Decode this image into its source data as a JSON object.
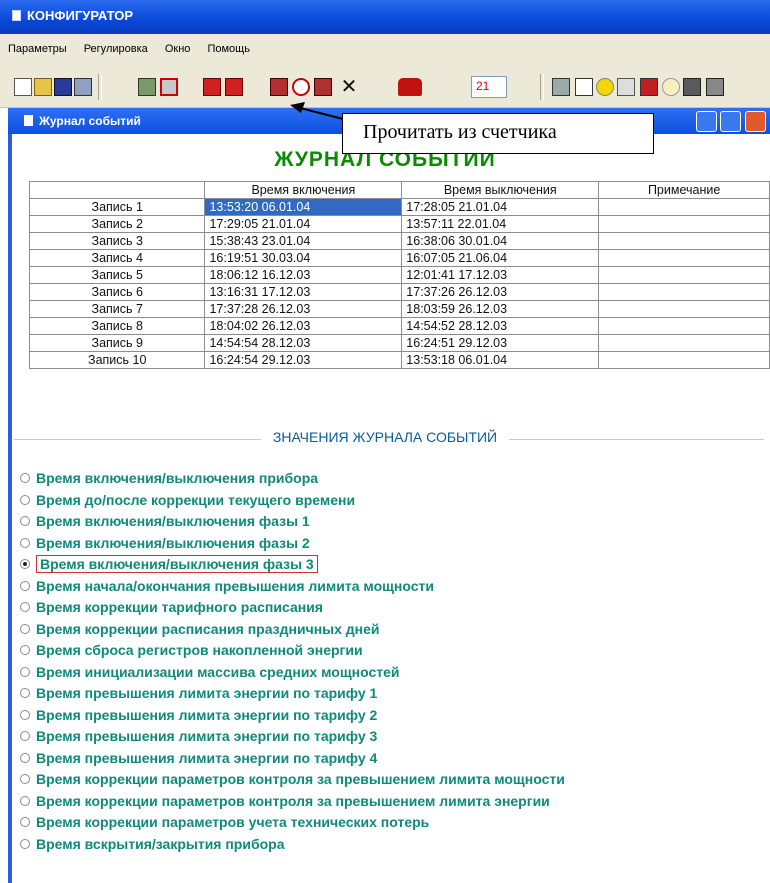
{
  "app": {
    "title": "КОНФИГУРАТОР"
  },
  "menu": [
    "Параметры",
    "Регулировка",
    "Окно",
    "Помощь"
  ],
  "toolbar": {
    "number_value": "21"
  },
  "window": {
    "title": "Журнал событий"
  },
  "callout": {
    "text": "Прочитать из счетчика"
  },
  "journal": {
    "title": "ЖУРНАЛ СОБЫТИЙ",
    "columns": [
      "Время включения",
      "Время выключения",
      "Примечание"
    ],
    "rows": [
      {
        "label": "Запись 1",
        "on": "13:53:20  06.01.04",
        "off": "17:28:05  21.01.04",
        "note": ""
      },
      {
        "label": "Запись 2",
        "on": "17:29:05  21.01.04",
        "off": "13:57:11  22.01.04",
        "note": ""
      },
      {
        "label": "Запись 3",
        "on": "15:38:43  23.01.04",
        "off": "16:38:06  30.01.04",
        "note": ""
      },
      {
        "label": "Запись 4",
        "on": "16:19:51  30.03.04",
        "off": "16:07:05  21.06.04",
        "note": ""
      },
      {
        "label": "Запись 5",
        "on": "18:06:12  16.12.03",
        "off": "12:01:41  17.12.03",
        "note": ""
      },
      {
        "label": "Запись 6",
        "on": "13:16:31  17.12.03",
        "off": "17:37:26  26.12.03",
        "note": ""
      },
      {
        "label": "Запись 7",
        "on": "17:37:28  26.12.03",
        "off": "18:03:59  26.12.03",
        "note": ""
      },
      {
        "label": "Запись 8",
        "on": "18:04:02  26.12.03",
        "off": "14:54:52  28.12.03",
        "note": ""
      },
      {
        "label": "Запись 9",
        "on": "14:54:54  28.12.03",
        "off": "16:24:51  29.12.03",
        "note": ""
      },
      {
        "label": "Запись 10",
        "on": "16:24:54  29.12.03",
        "off": "13:53:18  06.01.04",
        "note": ""
      }
    ]
  },
  "values_section": {
    "title": "ЗНАЧЕНИЯ ЖУРНАЛА СОБЫТИЙ",
    "options": [
      "Время включения/выключения прибора",
      "Время до/после коррекции текущего времени",
      "Время включения/выключения фазы 1",
      "Время включения/выключения фазы 2",
      "Время включения/выключения фазы 3",
      "Время начала/окончания превышения лимита мощности",
      "Время коррекции тарифного расписания",
      "Время коррекции  расписания праздничных дней",
      "Время сброса регистров накопленной энергии",
      "Время инициализации массива средних мощностей",
      "Время  превышения лимита  энергии по тарифу 1",
      "Время  превышения лимита  энергии по тарифу 2",
      "Время  превышения лимита  энергии по тарифу 3",
      "Время  превышения лимита  энергии по тарифу 4",
      "Время коррекции параметров контроля за превышением лимита мощности",
      "Время коррекции параметров контроля за превышением лимита энергии",
      "Время коррекции параметров учета технических потерь",
      "Время вскрытия/закрытия прибора"
    ],
    "selected_index": 4
  },
  "colors": {
    "title_bar": "#0a48d8",
    "accent_green": "#0a8a00",
    "option_teal": "#0f8a7a",
    "selection": "#316ac5"
  }
}
